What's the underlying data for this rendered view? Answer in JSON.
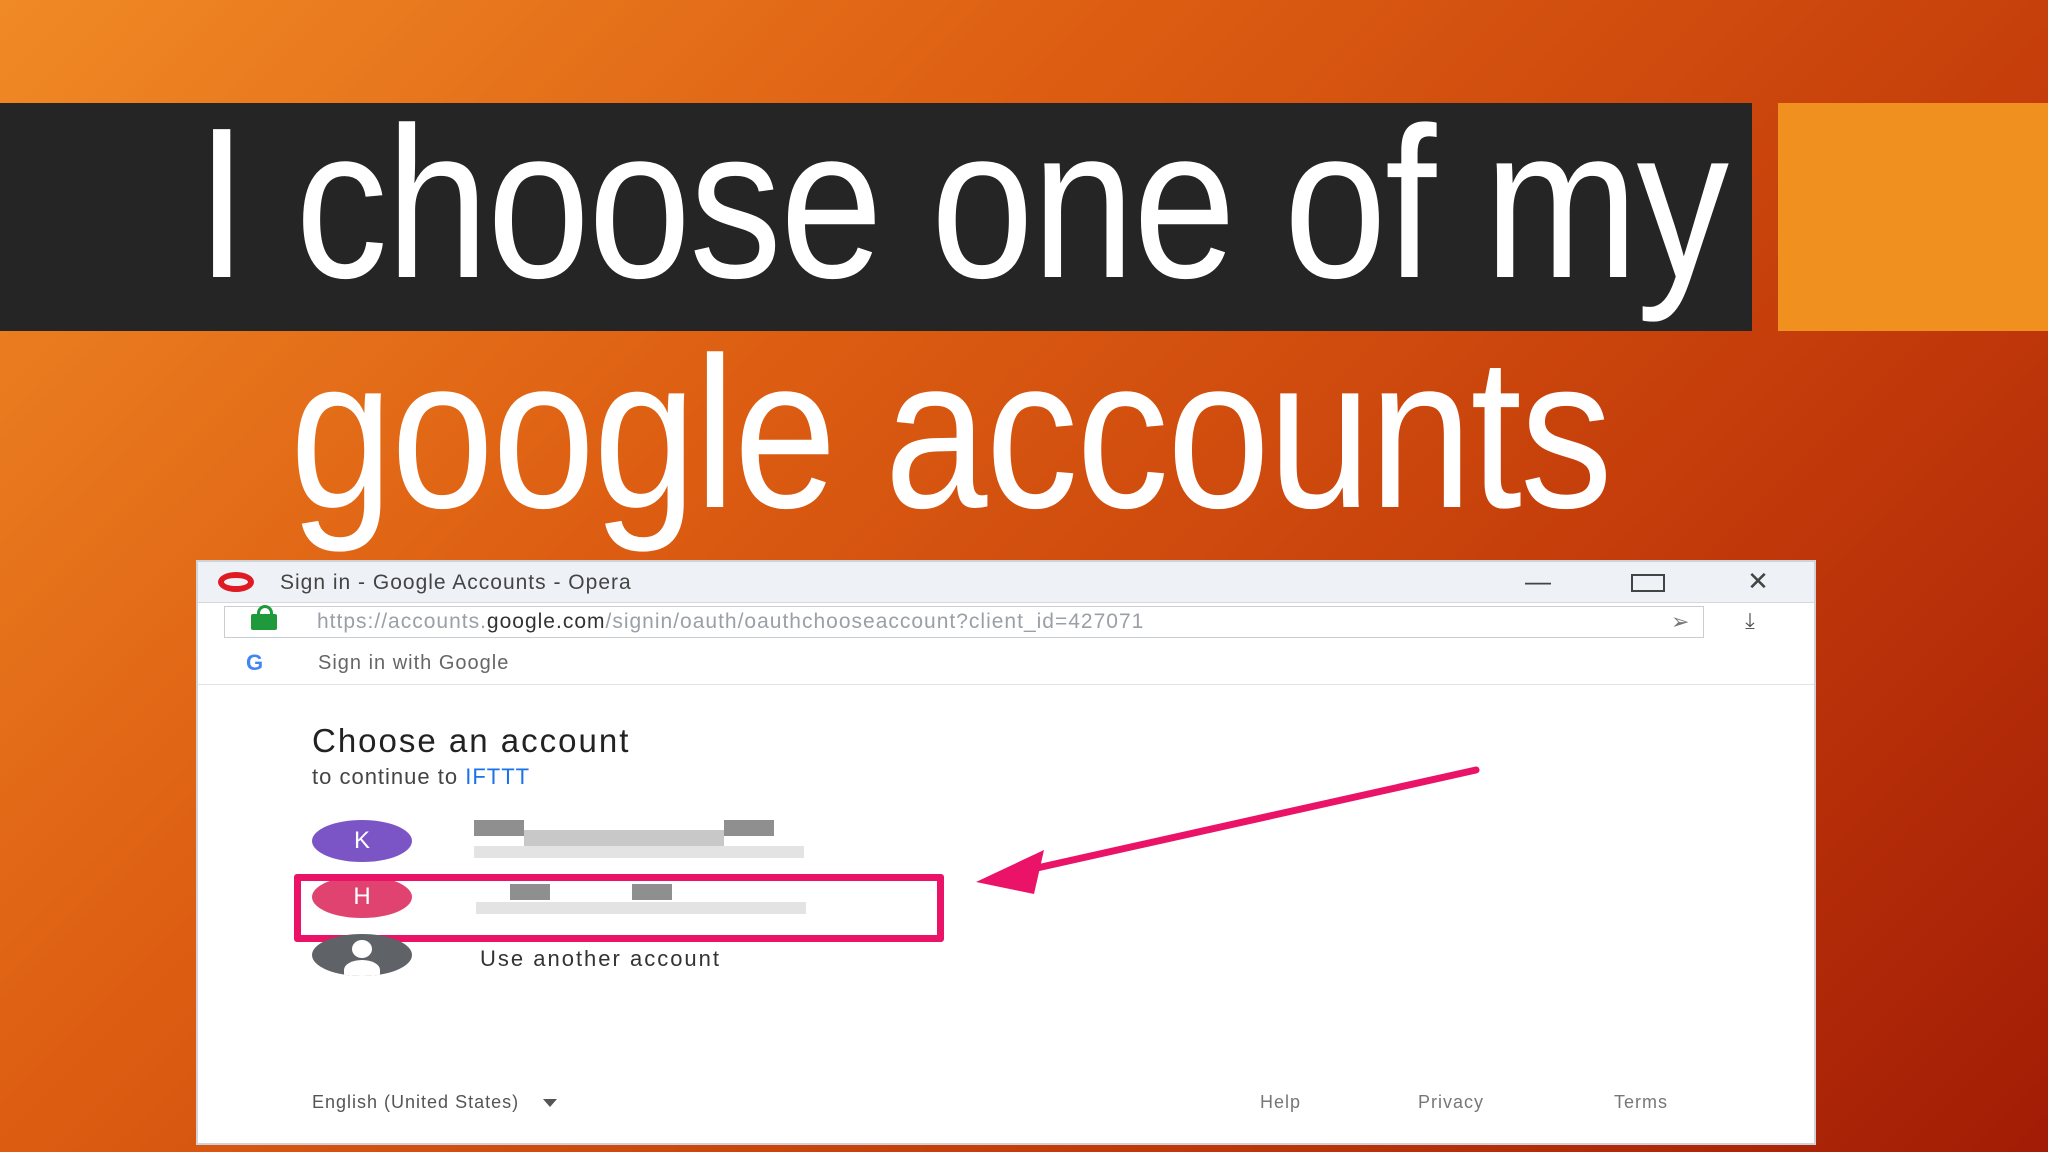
{
  "slide": {
    "title_line1": "I choose one of my",
    "title_line2": "google accounts"
  },
  "browser": {
    "window_title": "Sign in - Google Accounts - Opera",
    "controls": {
      "minimize": "—",
      "close": "✕"
    },
    "url_prefix": "https://accounts.",
    "url_domain": "google.com",
    "url_suffix": "/signin/oauth/oauthchooseaccount?client_id=427071",
    "send_icon": "➢",
    "download_icon": "⤓"
  },
  "page": {
    "g_logo": "G",
    "signin_label": "Sign in with Google",
    "heading": "Choose an account",
    "continue_prefix": "to continue to ",
    "continue_app": "IFTTT",
    "accounts": [
      {
        "initial": "K"
      },
      {
        "initial": "H"
      }
    ],
    "other_account_label": "Use another account",
    "footer": {
      "language": "English (United States)",
      "help": "Help",
      "privacy": "Privacy",
      "terms": "Terms"
    }
  },
  "colors": {
    "highlight": "#ea1368",
    "avatar_k": "#7b55c6",
    "avatar_h": "#e0436f",
    "title_band": "#262525",
    "accent_orange": "#f0901e"
  }
}
